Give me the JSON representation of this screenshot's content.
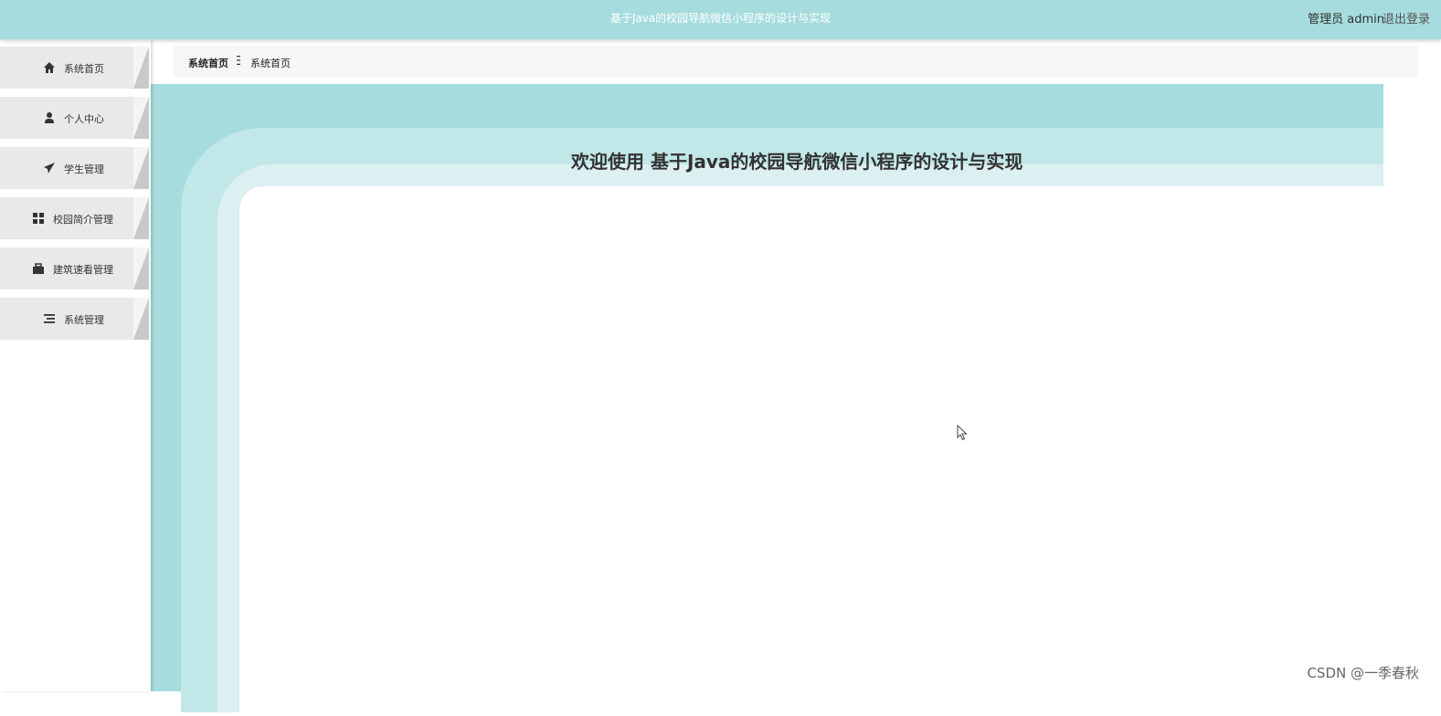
{
  "header": {
    "title": "基于Java的校园导航微信小程序的设计与实现",
    "user_label": "管理员 admin",
    "logout_label": "退出登录"
  },
  "sidebar": {
    "items": [
      {
        "label": "系统首页",
        "icon": "home-icon"
      },
      {
        "label": "个人中心",
        "icon": "user-icon"
      },
      {
        "label": "学生管理",
        "icon": "paper-plane-icon"
      },
      {
        "label": "校园简介管理",
        "icon": "grid-icon"
      },
      {
        "label": "建筑速看管理",
        "icon": "briefcase-icon"
      },
      {
        "label": "系统管理",
        "icon": "list-icon"
      }
    ]
  },
  "breadcrumb": {
    "home": "系统首页",
    "current": "系统首页"
  },
  "main": {
    "welcome": "欢迎使用 基于Java的校园导航微信小程序的设计与实现"
  },
  "watermark": "CSDN @一季春秋",
  "colors": {
    "topbar": "#a6dcdd",
    "band_light": "#c2e7e8",
    "band_lighter": "#ddf0f1",
    "menu_bg": "#e9e8ea",
    "breadcrumb_bg": "#f8f5f8"
  }
}
